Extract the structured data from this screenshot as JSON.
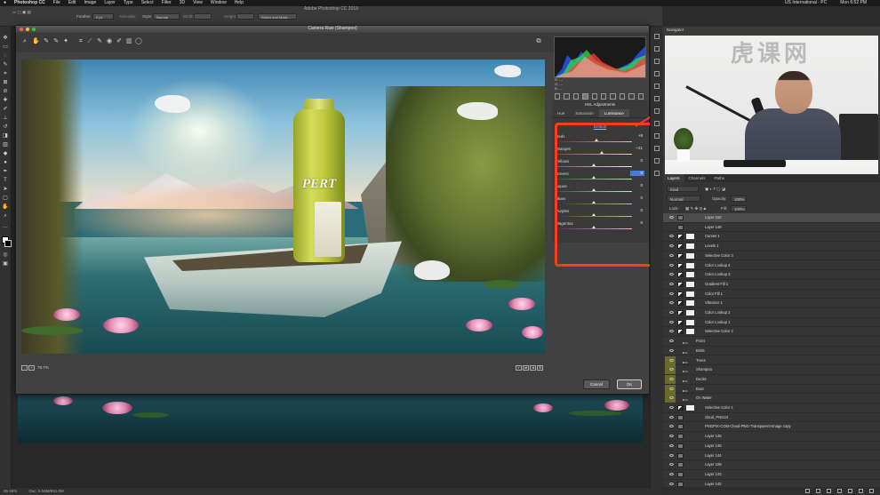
{
  "menubar": {
    "app": "Photoshop CC",
    "items": [
      "File",
      "Edit",
      "Image",
      "Layer",
      "Type",
      "Select",
      "Filter",
      "3D",
      "View",
      "Window",
      "Help"
    ],
    "right": [
      "US International - PC",
      "Mon 6:52 PM"
    ]
  },
  "app_title": "Adobe Photoshop CC 2019",
  "options": {
    "feather_label": "Feather:",
    "feather_value": "0 px",
    "antialias_label": "Anti-alias",
    "style_label": "Style:",
    "style_value": "Normal",
    "width_label": "Width:",
    "height_label": "Height:",
    "select_mask_label": "Select and Mask..."
  },
  "dialog": {
    "title": "Camera Raw (Shampoo)",
    "zoom_level": "78.7%",
    "rgb": [
      "R: ---",
      "G: ---",
      "B: ---"
    ],
    "cancel": "Cancel",
    "ok": "OK"
  },
  "preview": {
    "bottle_brand": "PERT"
  },
  "hsl": {
    "heading": "HSL Adjustments",
    "tabs": [
      "Hue",
      "Saturation",
      "Luminance"
    ],
    "active_tab": "Luminance",
    "default_link": "Default",
    "rows": [
      {
        "label": "Reds",
        "value": "+8",
        "pos": 0.54,
        "highlight": false,
        "colors": [
          "#7a1e1e",
          "#ffb0b0"
        ]
      },
      {
        "label": "Oranges",
        "value": "+21",
        "pos": 0.61,
        "highlight": false,
        "colors": [
          "#7a4a1e",
          "#ffd2a0"
        ]
      },
      {
        "label": "Yellows",
        "value": "0",
        "pos": 0.5,
        "highlight": false,
        "colors": [
          "#6a6a1e",
          "#fff6a8"
        ]
      },
      {
        "label": "Greens",
        "value": "0",
        "pos": 0.5,
        "highlight": true,
        "colors": [
          "#1e5a1e",
          "#a8f0a8"
        ]
      },
      {
        "label": "Aquas",
        "value": "0",
        "pos": 0.5,
        "highlight": false,
        "colors": [
          "#1e5a5a",
          "#a8f0f0"
        ]
      },
      {
        "label": "Blues",
        "value": "0",
        "pos": 0.5,
        "highlight": false,
        "colors": [
          "#1e2a6a",
          "#a8b8ff"
        ]
      },
      {
        "label": "Purples",
        "value": "0",
        "pos": 0.5,
        "highlight": false,
        "colors": [
          "#4a1e6a",
          "#d8a8ff"
        ]
      },
      {
        "label": "Magentas",
        "value": "0",
        "pos": 0.5,
        "highlight": false,
        "colors": [
          "#6a1e4a",
          "#ffa8e0"
        ]
      }
    ]
  },
  "navigator": {
    "tab": "Navigator",
    "zoom": "66.66%",
    "logo": "虎课网"
  },
  "layers": {
    "tabs": [
      "Layers",
      "Channels",
      "Paths"
    ],
    "active_tab": "Layers",
    "kind": "Kind",
    "blend_mode": "Normal",
    "opacity_label": "Opacity:",
    "opacity": "100%",
    "lock_label": "Lock:",
    "fill_label": "Fill:",
    "fill": "100%",
    "list": [
      {
        "name": "Layer 150",
        "type": "layer",
        "selected": true,
        "visible": true
      },
      {
        "name": "Layer 149",
        "type": "layer",
        "selected": false,
        "visible": false
      },
      {
        "name": "Curves 1",
        "type": "adjust",
        "selected": false,
        "visible": true
      },
      {
        "name": "Levels 1",
        "type": "adjust",
        "selected": false,
        "visible": true
      },
      {
        "name": "Selective Color 3",
        "type": "adjust",
        "selected": false,
        "visible": true
      },
      {
        "name": "Color Lookup 4",
        "type": "adjust",
        "selected": false,
        "visible": true
      },
      {
        "name": "Color Lookup 3",
        "type": "adjust",
        "selected": false,
        "visible": true
      },
      {
        "name": "Gradient Fill 1",
        "type": "adjust",
        "selected": false,
        "visible": true
      },
      {
        "name": "Color Fill 1",
        "type": "adjust",
        "selected": false,
        "visible": true
      },
      {
        "name": "Vibrance 1",
        "type": "adjust",
        "selected": false,
        "visible": true
      },
      {
        "name": "Color Lookup 2",
        "type": "adjust",
        "selected": false,
        "visible": true
      },
      {
        "name": "Color Lookup 1",
        "type": "adjust",
        "selected": false,
        "visible": true
      },
      {
        "name": "Selective Color 2",
        "type": "adjust",
        "selected": false,
        "visible": true
      },
      {
        "name": "Front",
        "type": "folder",
        "selected": false,
        "visible": true
      },
      {
        "name": "Birds",
        "type": "folder",
        "selected": false,
        "visible": true
      },
      {
        "name": "Trees",
        "type": "folder",
        "selected": false,
        "visible": true
      },
      {
        "name": "Shampoo",
        "type": "folder",
        "selected": false,
        "visible": true
      },
      {
        "name": "Ducks",
        "type": "folder",
        "selected": false,
        "visible": true
      },
      {
        "name": "Boat",
        "type": "folder",
        "selected": false,
        "visible": true
      },
      {
        "name": "On Water",
        "type": "folder",
        "selected": false,
        "visible": true
      },
      {
        "name": "Selective Color 1",
        "type": "adjust",
        "selected": false,
        "visible": true
      },
      {
        "name": "cloud_PNG24",
        "type": "layer",
        "selected": false,
        "visible": true
      },
      {
        "name": "PNGPIX-COM-Cloud-PNG-Transparent-Image copy",
        "type": "layer",
        "selected": false,
        "visible": true
      },
      {
        "name": "Layer 145",
        "type": "layer",
        "selected": false,
        "visible": true
      },
      {
        "name": "Layer 146",
        "type": "layer",
        "selected": false,
        "visible": true
      },
      {
        "name": "Layer 144",
        "type": "layer",
        "selected": false,
        "visible": true
      },
      {
        "name": "Layer 109",
        "type": "layer",
        "selected": false,
        "visible": true
      },
      {
        "name": "Layer 143",
        "type": "layer",
        "selected": false,
        "visible": true
      },
      {
        "name": "Layer 142",
        "type": "layer",
        "selected": false,
        "visible": true
      }
    ]
  },
  "status": {
    "zoom": "66.66%",
    "doc": "Doc: 6.59M/831.0M"
  },
  "icons": [
    "move-icon",
    "marquee-icon",
    "lasso-icon",
    "crop-icon",
    "eyedropper-icon",
    "brush-icon",
    "eraser-icon",
    "gradient-icon",
    "text-icon",
    "hand-icon",
    "zoom-icon",
    "eye-icon",
    "folder-icon"
  ],
  "colors": {
    "highlight_box": "#ff3a1f",
    "selected_value": "#4a7ad8",
    "link": "#8ab4ff"
  }
}
